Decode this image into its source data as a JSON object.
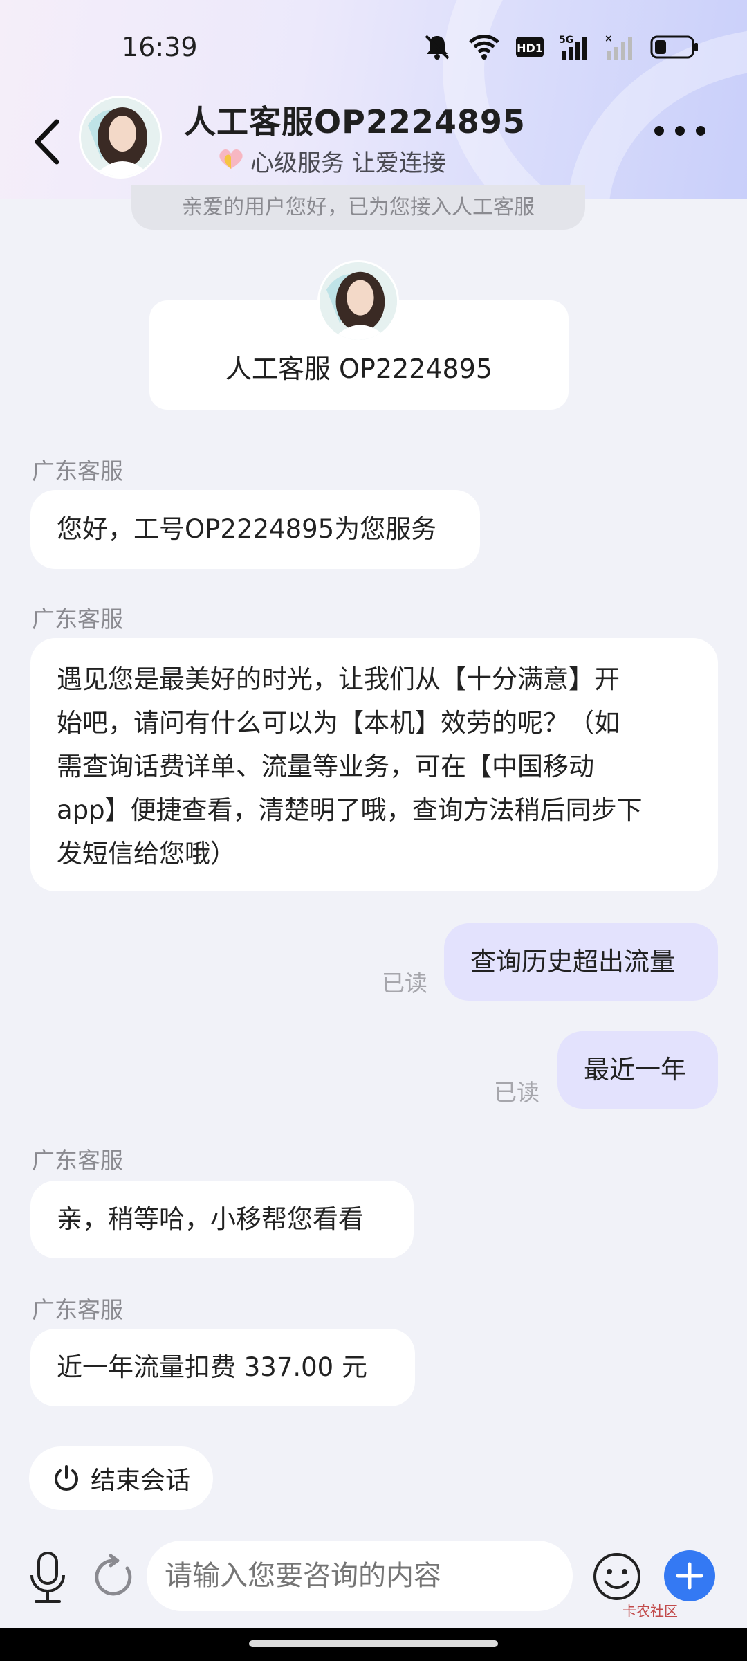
{
  "status_bar": {
    "time": "16:39",
    "network": "5G",
    "hd_badge": "HD1"
  },
  "header": {
    "title": "人工客服OP2224895",
    "subtitle": "心级服务 让爱连接",
    "back_icon": "chevron-left-icon",
    "more_icon": "more-dots-icon"
  },
  "system_notice": "亲爱的用户您好，已为您接入人工客服",
  "agent_card": {
    "name": "人工客服 OP2224895"
  },
  "messages": [
    {
      "sender": "广东客服",
      "text": "您好，工号OP2224895为您服务"
    },
    {
      "sender": "广东客服",
      "lines": [
        "遇见您是最美好的时光，让我们从【十分满意】开",
        "始吧，请问有什么可以为【本机】效劳的呢？（如",
        "需查询话费详单、流量等业务，可在【中国移动",
        "app】便捷查看，清楚明了哦，查询方法稍后同步下",
        "发短信给您哦）"
      ]
    },
    {
      "mine": true,
      "text": "查询历史超出流量",
      "status": "已读"
    },
    {
      "mine": true,
      "text": "最近一年",
      "status": "已读"
    },
    {
      "sender": "广东客服",
      "text": "亲，稍等哈，小移帮您看看"
    },
    {
      "sender": "广东客服",
      "text": "近一年流量扣费 337.00 元"
    }
  ],
  "end_session_label": "结束会话",
  "input": {
    "placeholder": "请输入您要咨询的内容"
  },
  "watermark": "卡农社区",
  "colors": {
    "accent": "#3479f3",
    "my_bubble": "#e3e2fd",
    "background": "#f1f2f8"
  }
}
